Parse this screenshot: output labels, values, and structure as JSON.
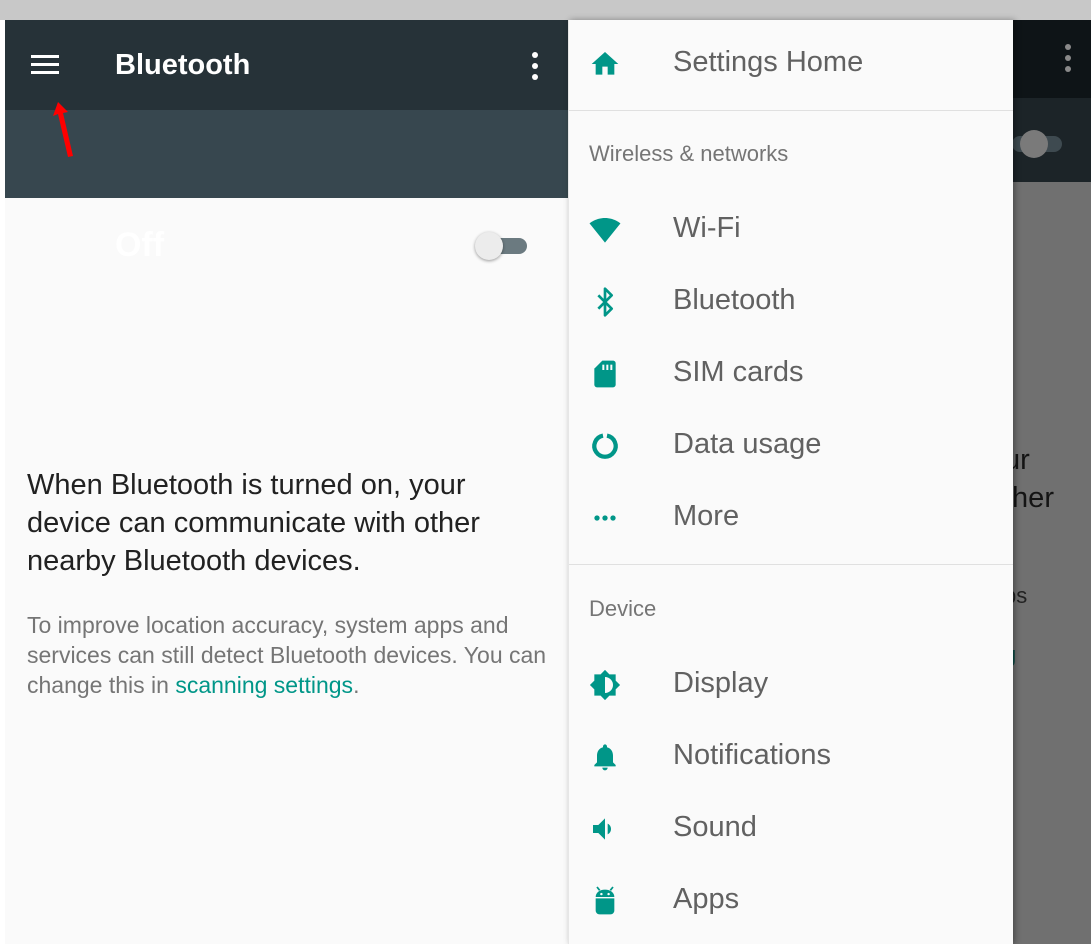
{
  "toolbar": {
    "title": "Bluetooth"
  },
  "switch": {
    "label": "Off",
    "state": "off"
  },
  "body": {
    "main": "When Bluetooth is turned on, your device can communicate with other nearby Bluetooth devices.",
    "sub_prefix": "To improve location accuracy, system apps and services can still detect Bluetooth devices. You can change this in ",
    "sub_link": "scanning settings",
    "sub_suffix": "."
  },
  "background_fragments": [
    "ur",
    "ther",
    "ps",
    "g"
  ],
  "drawer": {
    "home": {
      "label": "Settings Home",
      "icon": "home-icon"
    },
    "sections": [
      {
        "title": "Wireless & networks",
        "items": [
          {
            "label": "Wi-Fi",
            "icon": "wifi-icon"
          },
          {
            "label": "Bluetooth",
            "icon": "bluetooth-icon"
          },
          {
            "label": "SIM cards",
            "icon": "sim-card-icon"
          },
          {
            "label": "Data usage",
            "icon": "data-usage-icon"
          },
          {
            "label": "More",
            "icon": "more-horiz-icon"
          }
        ]
      },
      {
        "title": "Device",
        "items": [
          {
            "label": "Display",
            "icon": "brightness-icon"
          },
          {
            "label": "Notifications",
            "icon": "bell-icon"
          },
          {
            "label": "Sound",
            "icon": "volume-icon"
          },
          {
            "label": "Apps",
            "icon": "android-icon"
          }
        ]
      }
    ]
  },
  "colors": {
    "accent": "#009688",
    "toolbar": "#263238",
    "switchbar": "#37474f",
    "annotation_arrow": "#ff0000"
  }
}
